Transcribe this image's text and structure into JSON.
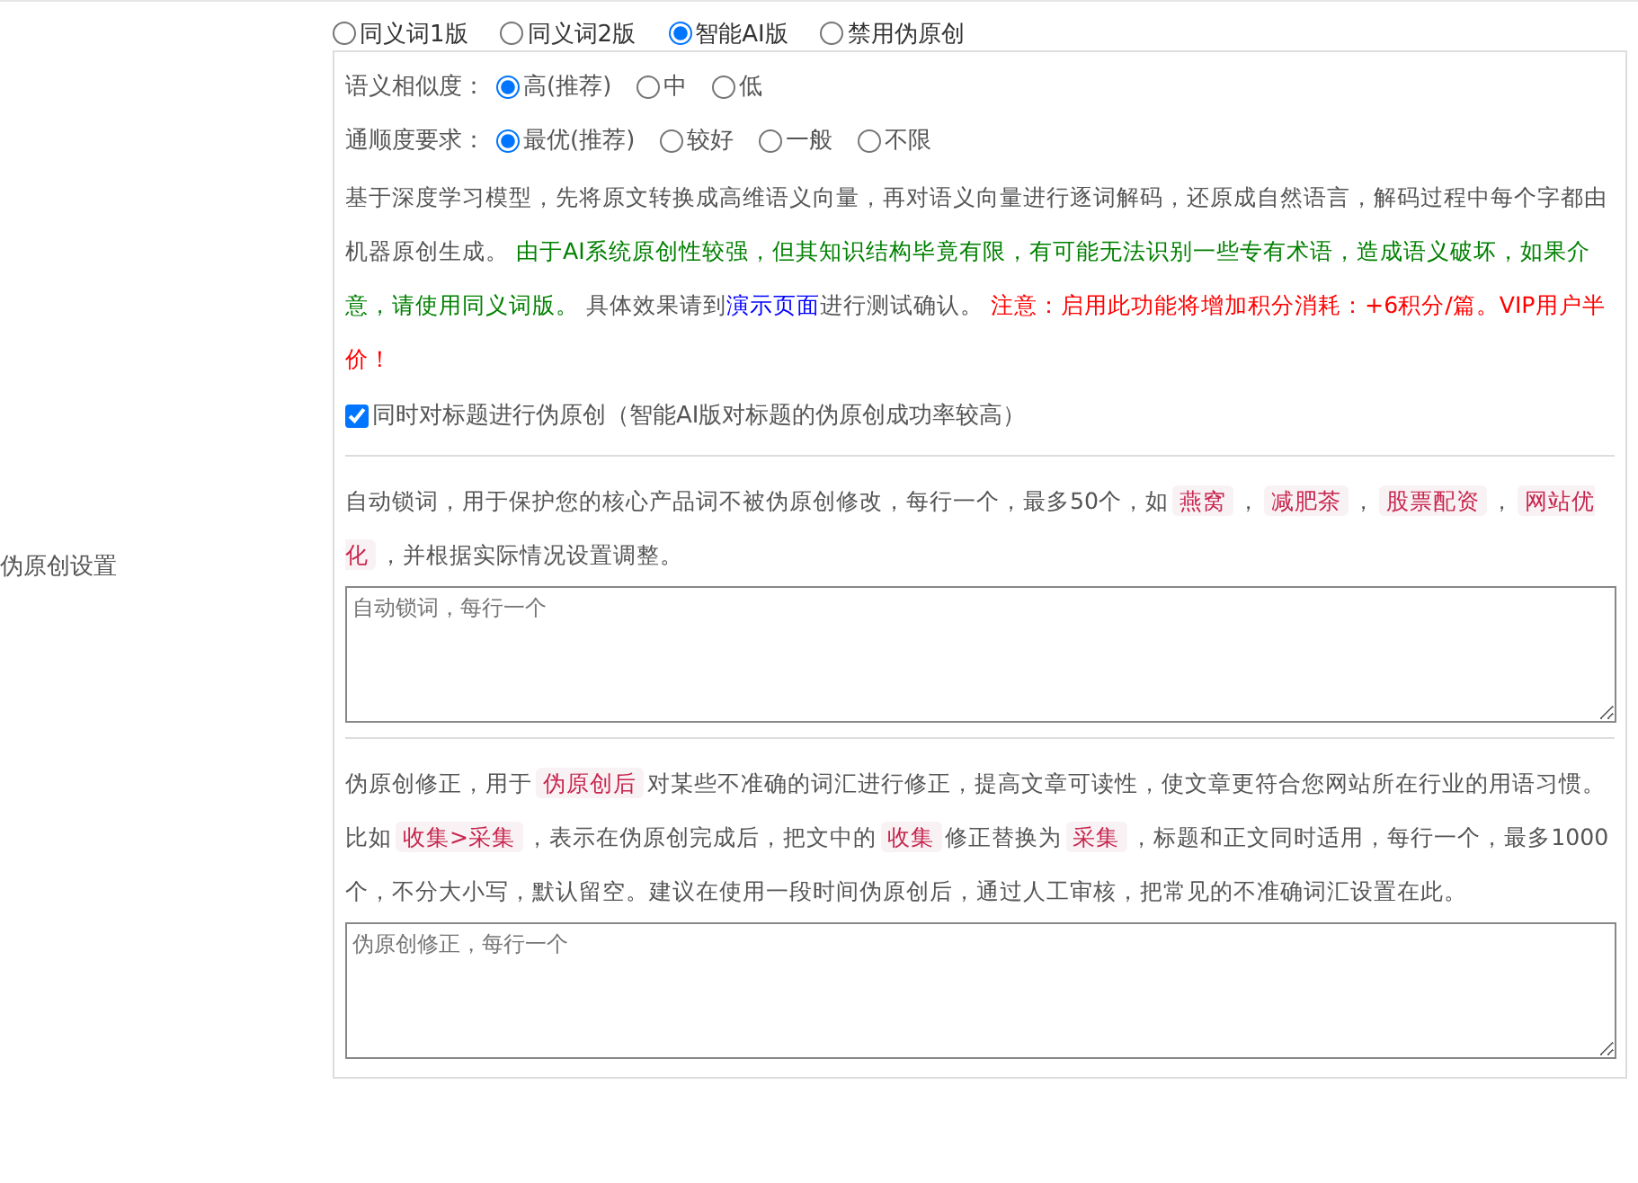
{
  "mode_options": [
    {
      "label": "同义词1版",
      "selected": false
    },
    {
      "label": "同义词2版",
      "selected": false
    },
    {
      "label": "智能AI版",
      "selected": true
    },
    {
      "label": "禁用伪原创",
      "selected": false
    }
  ],
  "similarity": {
    "label": "语义相似度：",
    "options": [
      {
        "label": "高(推荐)",
        "selected": true
      },
      {
        "label": "中",
        "selected": false
      },
      {
        "label": "低",
        "selected": false
      }
    ]
  },
  "fluency": {
    "label": "通顺度要求：",
    "options": [
      {
        "label": "最优(推荐)",
        "selected": true
      },
      {
        "label": "较好",
        "selected": false
      },
      {
        "label": "一般",
        "selected": false
      },
      {
        "label": "不限",
        "selected": false
      }
    ]
  },
  "description": [
    {
      "kind": "plain",
      "text": "基于深度学习模型，先将原文转换成高维语义向量，再对语义向量进行逐词解码，还原成自然语言，解码过程中每个字都由机器原创生成。 "
    },
    {
      "kind": "note",
      "text": "由于AI系统原创性较强，但其知识结构毕竟有限，有可能无法识别一些专有术语，造成语义破坏，如果介意，请使用同义词版。"
    },
    {
      "kind": "plain",
      "text": " 具体效果请到"
    },
    {
      "kind": "link",
      "text": "演示页面"
    },
    {
      "kind": "plain",
      "text": "进行测试确认。 "
    },
    {
      "kind": "warning",
      "text": "注意：启用此功能将增加积分消耗：+6积分/篇。VIP用户半价！"
    }
  ],
  "title_option": {
    "label": "同时对标题进行伪原创（智能AI版对标题的伪原创成功率较高）",
    "checked": true
  },
  "section_label": "伪原创设置",
  "lock_words": {
    "help": [
      {
        "kind": "text",
        "text": "自动锁词，用于保护您的核心产品词不被伪原创修改，每行一个，最多50个，如"
      },
      {
        "kind": "chip",
        "text": "燕窝"
      },
      {
        "kind": "text",
        "text": "，"
      },
      {
        "kind": "chip",
        "text": "减肥茶"
      },
      {
        "kind": "text",
        "text": "，"
      },
      {
        "kind": "chip",
        "text": "股票配资"
      },
      {
        "kind": "text",
        "text": "，"
      },
      {
        "kind": "chip",
        "text": "网站优化"
      },
      {
        "kind": "text",
        "text": "，并根据实际情况设置调整。"
      }
    ],
    "placeholder": "自动锁词，每行一个"
  },
  "corrections": {
    "help": [
      {
        "kind": "text",
        "text": "伪原创修正，用于"
      },
      {
        "kind": "chip",
        "text": "伪原创后"
      },
      {
        "kind": "text",
        "text": "对某些不准确的词汇进行修正，提高文章可读性，使文章更符合您网站所在行业的用语习惯。比如"
      },
      {
        "kind": "chip",
        "text": "收集>采集"
      },
      {
        "kind": "text",
        "text": "，表示在伪原创完成后，把文中的"
      },
      {
        "kind": "chip",
        "text": "收集"
      },
      {
        "kind": "text",
        "text": "修正替换为"
      },
      {
        "kind": "chip",
        "text": "采集"
      },
      {
        "kind": "text",
        "text": "，标题和正文同时适用，每行一个，最多1000个，不分大小写，默认留空。建议在使用一段时间伪原创后，通过人工审核，把常见的不准确词汇设置在此。"
      }
    ],
    "placeholder": "伪原创修正，每行一个"
  }
}
